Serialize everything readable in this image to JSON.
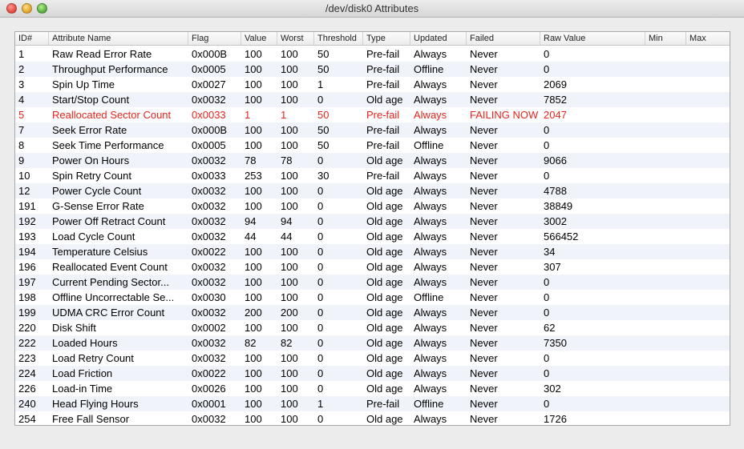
{
  "window": {
    "title": "/dev/disk0 Attributes"
  },
  "columns": {
    "id": "ID#",
    "name": "Attribute Name",
    "flag": "Flag",
    "value": "Value",
    "worst": "Worst",
    "threshold": "Threshold",
    "type": "Type",
    "updated": "Updated",
    "failed": "Failed",
    "raw": "Raw Value",
    "min": "Min",
    "max": "Max"
  },
  "colors": {
    "failing_text": "#e8231c",
    "alt_row": "#f0f4fa"
  },
  "rows": [
    {
      "id": "1",
      "name": "Raw Read Error Rate",
      "flag": "0x000B",
      "value": "100",
      "worst": "100",
      "threshold": "50",
      "type": "Pre-fail",
      "updated": "Always",
      "failed": "Never",
      "raw": "0",
      "min": "",
      "max": "",
      "failing": false
    },
    {
      "id": "2",
      "name": "Throughput Performance",
      "flag": "0x0005",
      "value": "100",
      "worst": "100",
      "threshold": "50",
      "type": "Pre-fail",
      "updated": "Offline",
      "failed": "Never",
      "raw": "0",
      "min": "",
      "max": "",
      "failing": false
    },
    {
      "id": "3",
      "name": "Spin Up Time",
      "flag": "0x0027",
      "value": "100",
      "worst": "100",
      "threshold": "1",
      "type": "Pre-fail",
      "updated": "Always",
      "failed": "Never",
      "raw": "2069",
      "min": "",
      "max": "",
      "failing": false
    },
    {
      "id": "4",
      "name": "Start/Stop Count",
      "flag": "0x0032",
      "value": "100",
      "worst": "100",
      "threshold": "0",
      "type": "Old age",
      "updated": "Always",
      "failed": "Never",
      "raw": "7852",
      "min": "",
      "max": "",
      "failing": false
    },
    {
      "id": "5",
      "name": "Reallocated Sector Count",
      "flag": "0x0033",
      "value": "1",
      "worst": "1",
      "threshold": "50",
      "type": "Pre-fail",
      "updated": "Always",
      "failed": "FAILING NOW",
      "raw": "2047",
      "min": "",
      "max": "",
      "failing": true
    },
    {
      "id": "7",
      "name": "Seek Error Rate",
      "flag": "0x000B",
      "value": "100",
      "worst": "100",
      "threshold": "50",
      "type": "Pre-fail",
      "updated": "Always",
      "failed": "Never",
      "raw": "0",
      "min": "",
      "max": "",
      "failing": false
    },
    {
      "id": "8",
      "name": "Seek Time Performance",
      "flag": "0x0005",
      "value": "100",
      "worst": "100",
      "threshold": "50",
      "type": "Pre-fail",
      "updated": "Offline",
      "failed": "Never",
      "raw": "0",
      "min": "",
      "max": "",
      "failing": false
    },
    {
      "id": "9",
      "name": "Power On Hours",
      "flag": "0x0032",
      "value": "78",
      "worst": "78",
      "threshold": "0",
      "type": "Old age",
      "updated": "Always",
      "failed": "Never",
      "raw": "9066",
      "min": "",
      "max": "",
      "failing": false
    },
    {
      "id": "10",
      "name": "Spin Retry Count",
      "flag": "0x0033",
      "value": "253",
      "worst": "100",
      "threshold": "30",
      "type": "Pre-fail",
      "updated": "Always",
      "failed": "Never",
      "raw": "0",
      "min": "",
      "max": "",
      "failing": false
    },
    {
      "id": "12",
      "name": "Power Cycle Count",
      "flag": "0x0032",
      "value": "100",
      "worst": "100",
      "threshold": "0",
      "type": "Old age",
      "updated": "Always",
      "failed": "Never",
      "raw": "4788",
      "min": "",
      "max": "",
      "failing": false
    },
    {
      "id": "191",
      "name": "G-Sense Error Rate",
      "flag": "0x0032",
      "value": "100",
      "worst": "100",
      "threshold": "0",
      "type": "Old age",
      "updated": "Always",
      "failed": "Never",
      "raw": "38849",
      "min": "",
      "max": "",
      "failing": false
    },
    {
      "id": "192",
      "name": "Power Off Retract Count",
      "flag": "0x0032",
      "value": "94",
      "worst": "94",
      "threshold": "0",
      "type": "Old age",
      "updated": "Always",
      "failed": "Never",
      "raw": "3002",
      "min": "",
      "max": "",
      "failing": false
    },
    {
      "id": "193",
      "name": "Load Cycle Count",
      "flag": "0x0032",
      "value": "44",
      "worst": "44",
      "threshold": "0",
      "type": "Old age",
      "updated": "Always",
      "failed": "Never",
      "raw": "566452",
      "min": "",
      "max": "",
      "failing": false
    },
    {
      "id": "194",
      "name": "Temperature Celsius",
      "flag": "0x0022",
      "value": "100",
      "worst": "100",
      "threshold": "0",
      "type": "Old age",
      "updated": "Always",
      "failed": "Never",
      "raw": "34",
      "min": "",
      "max": "",
      "failing": false
    },
    {
      "id": "196",
      "name": "Reallocated Event Count",
      "flag": "0x0032",
      "value": "100",
      "worst": "100",
      "threshold": "0",
      "type": "Old age",
      "updated": "Always",
      "failed": "Never",
      "raw": "307",
      "min": "",
      "max": "",
      "failing": false
    },
    {
      "id": "197",
      "name": "Current Pending Sector...",
      "flag": "0x0032",
      "value": "100",
      "worst": "100",
      "threshold": "0",
      "type": "Old age",
      "updated": "Always",
      "failed": "Never",
      "raw": "0",
      "min": "",
      "max": "",
      "failing": false
    },
    {
      "id": "198",
      "name": "Offline Uncorrectable Se...",
      "flag": "0x0030",
      "value": "100",
      "worst": "100",
      "threshold": "0",
      "type": "Old age",
      "updated": "Offline",
      "failed": "Never",
      "raw": "0",
      "min": "",
      "max": "",
      "failing": false
    },
    {
      "id": "199",
      "name": "UDMA CRC Error Count",
      "flag": "0x0032",
      "value": "200",
      "worst": "200",
      "threshold": "0",
      "type": "Old age",
      "updated": "Always",
      "failed": "Never",
      "raw": "0",
      "min": "",
      "max": "",
      "failing": false
    },
    {
      "id": "220",
      "name": "Disk Shift",
      "flag": "0x0002",
      "value": "100",
      "worst": "100",
      "threshold": "0",
      "type": "Old age",
      "updated": "Always",
      "failed": "Never",
      "raw": "62",
      "min": "",
      "max": "",
      "failing": false
    },
    {
      "id": "222",
      "name": "Loaded Hours",
      "flag": "0x0032",
      "value": "82",
      "worst": "82",
      "threshold": "0",
      "type": "Old age",
      "updated": "Always",
      "failed": "Never",
      "raw": "7350",
      "min": "",
      "max": "",
      "failing": false
    },
    {
      "id": "223",
      "name": "Load Retry Count",
      "flag": "0x0032",
      "value": "100",
      "worst": "100",
      "threshold": "0",
      "type": "Old age",
      "updated": "Always",
      "failed": "Never",
      "raw": "0",
      "min": "",
      "max": "",
      "failing": false
    },
    {
      "id": "224",
      "name": "Load Friction",
      "flag": "0x0022",
      "value": "100",
      "worst": "100",
      "threshold": "0",
      "type": "Old age",
      "updated": "Always",
      "failed": "Never",
      "raw": "0",
      "min": "",
      "max": "",
      "failing": false
    },
    {
      "id": "226",
      "name": "Load-in Time",
      "flag": "0x0026",
      "value": "100",
      "worst": "100",
      "threshold": "0",
      "type": "Old age",
      "updated": "Always",
      "failed": "Never",
      "raw": "302",
      "min": "",
      "max": "",
      "failing": false
    },
    {
      "id": "240",
      "name": "Head Flying Hours",
      "flag": "0x0001",
      "value": "100",
      "worst": "100",
      "threshold": "1",
      "type": "Pre-fail",
      "updated": "Offline",
      "failed": "Never",
      "raw": "0",
      "min": "",
      "max": "",
      "failing": false
    },
    {
      "id": "254",
      "name": "Free Fall Sensor",
      "flag": "0x0032",
      "value": "100",
      "worst": "100",
      "threshold": "0",
      "type": "Old age",
      "updated": "Always",
      "failed": "Never",
      "raw": "1726",
      "min": "",
      "max": "",
      "failing": false
    }
  ]
}
